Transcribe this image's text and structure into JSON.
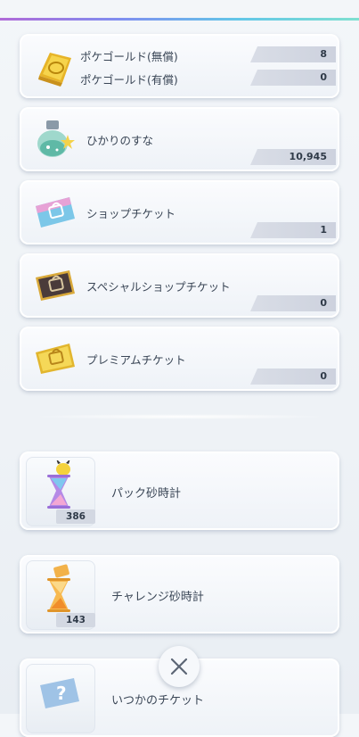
{
  "currencies": [
    {
      "label_free": "ポケゴールド(無償)",
      "value_free": "8",
      "label_paid": "ポケゴールド(有償)",
      "value_paid": "0",
      "icon": "gold-bar-icon"
    },
    {
      "label": "ひかりのすな",
      "value": "10,945",
      "icon": "shinedust-bottle-icon"
    },
    {
      "label": "ショップチケット",
      "value": "1",
      "icon": "shop-ticket-icon"
    },
    {
      "label": "スペシャルショップチケット",
      "value": "0",
      "icon": "special-shop-ticket-icon"
    },
    {
      "label": "プレミアムチケット",
      "value": "0",
      "icon": "premium-ticket-icon"
    }
  ],
  "hourglasses": [
    {
      "label": "パック砂時計",
      "count": "386",
      "icon": "pack-hourglass-icon"
    },
    {
      "label": "チャレンジ砂時計",
      "count": "143",
      "icon": "challenge-hourglass-icon"
    },
    {
      "label": "いつかのチケット",
      "count": "",
      "icon": "someday-ticket-icon"
    }
  ],
  "close_icon": "close-icon"
}
